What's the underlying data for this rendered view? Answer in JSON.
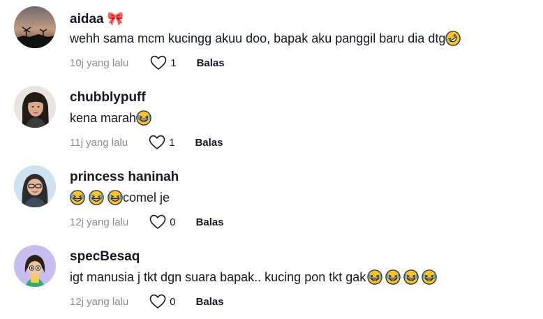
{
  "comments": [
    {
      "username": "aidaa 🎀",
      "text": "wehh sama mcm kucingg akuu doo, bapak aku panggil baru dia dtg ",
      "emojis": [
        "rolling-on-floor-laughing"
      ],
      "time": "10j yang lalu",
      "likes": "1",
      "reply": "Balas"
    },
    {
      "username": "chubblypuff",
      "text": "kena marah ",
      "emojis": [
        "grinning-squinting"
      ],
      "time": "11j yang lalu",
      "likes": "1",
      "reply": "Balas"
    },
    {
      "username": "princess haninah",
      "text": "comel je",
      "emojis": [
        "grinning-squinting",
        "grinning-squinting",
        "grinning-squinting"
      ],
      "time": "12j yang lalu",
      "likes": "0",
      "reply": "Balas"
    },
    {
      "username": "specBesaq",
      "text": "igt manusia j tkt dgn suara bapak.. kucing pon tkt gak",
      "emojis": [
        "grinning-squinting",
        "grinning-squinting",
        "grinning-squinting",
        "grinning-squinting"
      ],
      "time": "12j yang lalu",
      "likes": "0",
      "reply": "Balas"
    }
  ],
  "icons": {
    "like": "heart-outline-icon"
  },
  "colors": {
    "text": "#161823",
    "muted": "#8a8b91",
    "emoji": "#f7c431"
  }
}
